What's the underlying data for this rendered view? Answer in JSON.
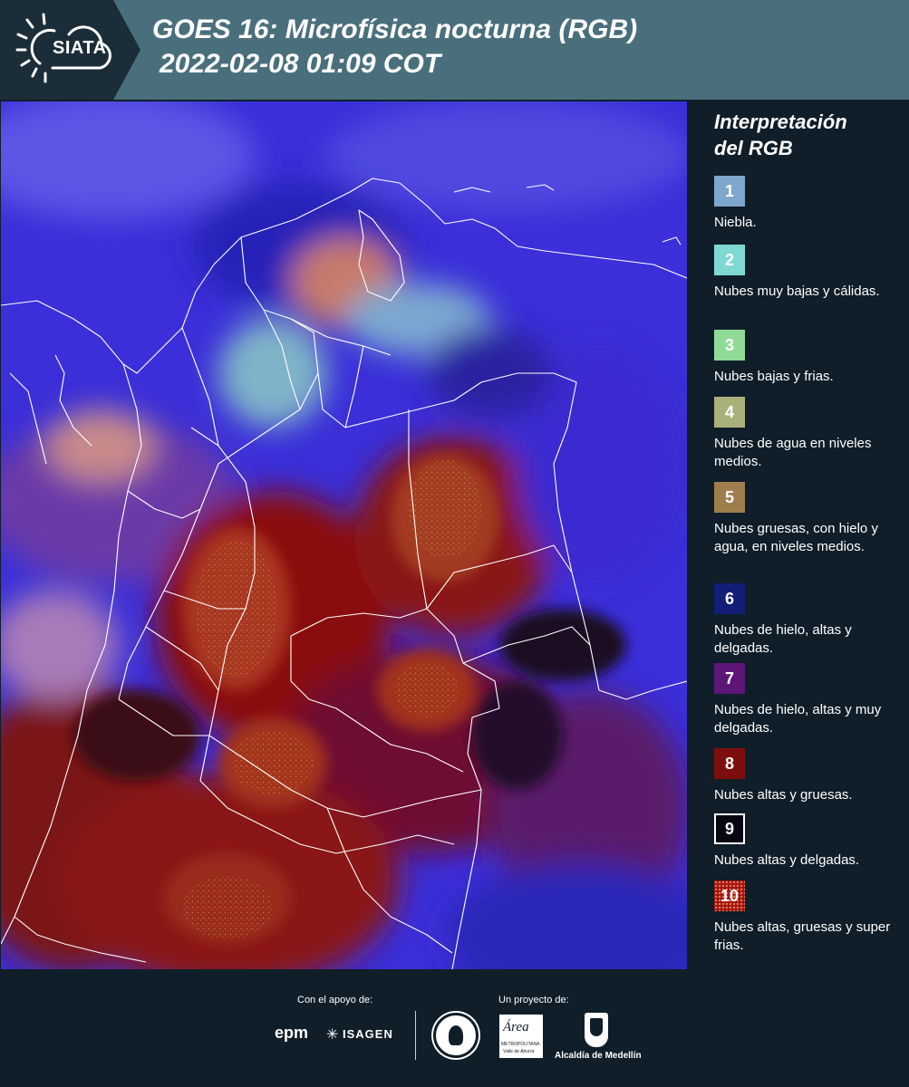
{
  "header": {
    "logo_text": "SIATA",
    "title_line1": "GOES 16: Microfísica nocturna (RGB)",
    "title_line2": "2022-02-08 01:09 COT"
  },
  "legend": {
    "title_line1": "Interpretación",
    "title_line2": "del RGB",
    "items": [
      {
        "num": "1",
        "label": "Niebla.",
        "color": "#7fa6cc"
      },
      {
        "num": "2",
        "label": "Nubes muy bajas y cálidas.",
        "color": "#7fd8d2"
      },
      {
        "num": "3",
        "label": "Nubes bajas y frias.",
        "color": "#8fdb95"
      },
      {
        "num": "4",
        "label": "Nubes de agua en niveles medios.",
        "color": "#a9b07a"
      },
      {
        "num": "5",
        "label": "Nubes gruesas, con hielo y agua, en niveles medios.",
        "color": "#9e7e4c"
      },
      {
        "num": "6",
        "label": "Nubes de hielo, altas y delgadas.",
        "color": "#141e78"
      },
      {
        "num": "7",
        "label": "Nubes de hielo, altas y muy delgadas.",
        "color": "#5c1678"
      },
      {
        "num": "8",
        "label": "Nubes altas y gruesas.",
        "color": "#7e0e0e"
      },
      {
        "num": "9",
        "label": "Nubes altas y delgadas.",
        "color": "#070714"
      },
      {
        "num": "10",
        "label": "Nubes altas, gruesas y super frias.",
        "color": "#a01010"
      }
    ]
  },
  "footer": {
    "support_label": "Con el apoyo de:",
    "project_label": "Un proyecto de:",
    "epm": "epm",
    "isagen": "ISAGEN",
    "amva_name": "Área",
    "amva_sub1": "METROPOLITANA",
    "amva_sub2": "Valle de Aburrá",
    "alcaldia": "Alcaldía de Medellín"
  }
}
